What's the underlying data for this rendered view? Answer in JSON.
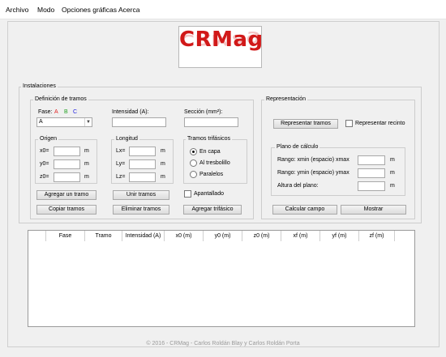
{
  "menu": [
    "Archivo",
    "Modo",
    "Opciones gráficas",
    "Acerca"
  ],
  "logo": {
    "text": "CRMag"
  },
  "instalaciones": {
    "label": "Instalaciones"
  },
  "definicion": {
    "label": "Definición de tramos",
    "fase_label": "Fase:",
    "fase_letters": [
      "A",
      "B",
      "C"
    ],
    "fase_colors": [
      "#e02020",
      "#20a020",
      "#2020e0"
    ],
    "fase_value": "A",
    "intensidad_label": "Intensidad (A):",
    "seccion_label": "Sección (mm²):",
    "origen": {
      "label": "Origen",
      "fields": [
        "x0=",
        "y0=",
        "z0="
      ],
      "unit": "m"
    },
    "longitud": {
      "label": "Longitud",
      "fields": [
        "Lx=",
        "Ly=",
        "Lz="
      ],
      "unit": "m"
    },
    "trifasicos": {
      "label": "Tramos trifásicos",
      "options": [
        "En capa",
        "Al tresbolillo",
        "Paralelos"
      ],
      "selected": "En capa"
    },
    "apantallado_label": "Apantallado",
    "buttons": {
      "agregar_tramo": "Agregar un tramo",
      "copiar_tramos": "Copiar tramos",
      "unir_tramos": "Unir tramos",
      "eliminar_tramos": "Eliminar tramos",
      "agregar_trifasico": "Agregar trifásico"
    }
  },
  "representacion": {
    "label": "Representación",
    "representar_tramos": "Representar tramos",
    "representar_recinto": "Representar recinto",
    "plano": {
      "label": "Plano de cálculo",
      "rango_x": "Rango: xmin (espacio) xmax",
      "rango_y": "Rango: ymin (espacio) ymax",
      "altura": "Altura del plano:",
      "unit": "m"
    },
    "calcular_campo": "Calcular campo",
    "mostrar": "Mostrar"
  },
  "table": {
    "columns": [
      "",
      "Fase",
      "Tramo",
      "Intensidad (A)",
      "x0 (m)",
      "y0 (m)",
      "z0 (m)",
      "xf (m)",
      "yf (m)",
      "zf (m)"
    ]
  },
  "footer": "© 2016 - CRMag - Carlos Roldán Blay y Carlos Roldán Porta"
}
